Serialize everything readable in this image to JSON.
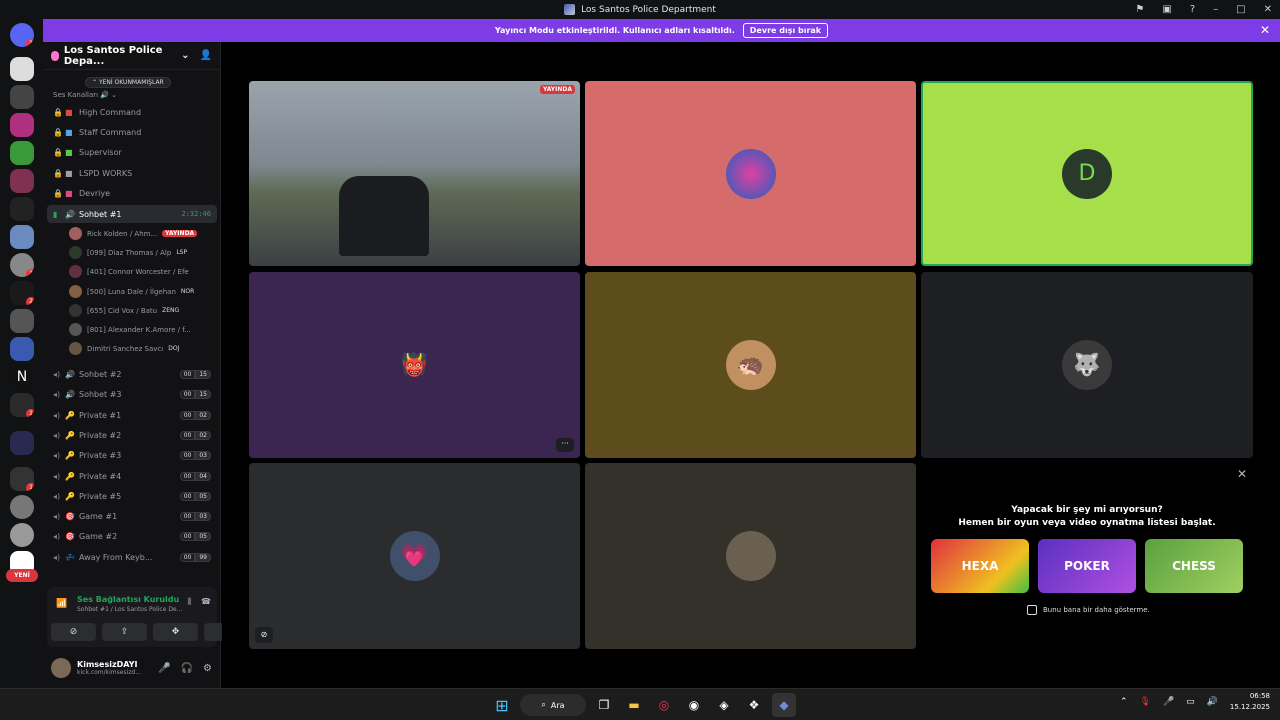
{
  "window": {
    "title": "Los Santos Police Department"
  },
  "banner": {
    "text": "Yayıncı Modu etkinleştirildi. Kullanıcı adları kısaltıldı.",
    "button": "Devre dışı bırak"
  },
  "guild_badges": {
    "top": "3",
    "b1": "1",
    "b2": "2",
    "b3": "1",
    "b4": "1"
  },
  "guild_new_label": "YENİ",
  "sidebar": {
    "server_name": "Los Santos Police Depa...",
    "unread_pill": "YENİ OKUNMAMIŞLAR",
    "category": "Ses Kanalları",
    "channels_top": [
      {
        "name": "High Command",
        "color": "#e0493e"
      },
      {
        "name": "Staff Command",
        "color": "#4ea8e6"
      },
      {
        "name": "Supervisor",
        "color": "#57c94e"
      },
      {
        "name": "LSPD WORKS",
        "color": "#9aa0a6"
      },
      {
        "name": "Devriye",
        "color": "#e34a7a"
      }
    ],
    "active_channel": {
      "name": "Sohbet #1",
      "timer": "2:32:46"
    },
    "members": [
      {
        "name": "Rick Kolden / Ahm...",
        "tag": "YAYINDA"
      },
      {
        "name": "[099] Diaz Thomas / Alp",
        "tag": "LSP"
      },
      {
        "name": "[401] Connor Worcester / Efe",
        "tag": ""
      },
      {
        "name": "[500] Luna Dale / İlgehan",
        "tag": "NOR"
      },
      {
        "name": "[655] Cid Vox / Batu",
        "tag": "ZENG"
      },
      {
        "name": "[801] Alexander K.Amore / f...",
        "tag": ""
      },
      {
        "name": "Dimitri Sanchez Savcı",
        "tag": "DOJ"
      }
    ],
    "channels_bottom": [
      {
        "name": "Sohbet #2",
        "a": "00",
        "b": "15",
        "icon": "🔊"
      },
      {
        "name": "Sohbet #3",
        "a": "00",
        "b": "15",
        "icon": "🔊"
      },
      {
        "name": "Private #1",
        "a": "00",
        "b": "02",
        "icon": "🔑"
      },
      {
        "name": "Private #2",
        "a": "00",
        "b": "02",
        "icon": "🔑"
      },
      {
        "name": "Private #3",
        "a": "00",
        "b": "03",
        "icon": "🔑"
      },
      {
        "name": "Private #4",
        "a": "00",
        "b": "04",
        "icon": "🔑"
      },
      {
        "name": "Private #5",
        "a": "00",
        "b": "05",
        "icon": "🔑"
      },
      {
        "name": "Game #1",
        "a": "00",
        "b": "03",
        "icon": "🎯"
      },
      {
        "name": "Game #2",
        "a": "00",
        "b": "05",
        "icon": "🎯"
      },
      {
        "name": "Away From Keyb...",
        "a": "00",
        "b": "99",
        "icon": "💤"
      }
    ]
  },
  "voice": {
    "status": "Ses Bağlantısı Kuruldu",
    "channel": "Sohbet #1 / Los Santos Police De..."
  },
  "user": {
    "name": "KimsesizDAYI",
    "status": "kick.com/kimsesizd..."
  },
  "stage": {
    "live_label": "YAYINDA"
  },
  "activity": {
    "heading1": "Yapacak bir şey mi arıyorsun?",
    "heading2": "Hemen bir oyun veya video oynatma listesi başlat.",
    "games": [
      "HEXA",
      "POKER",
      "CHESS"
    ],
    "checkbox": "Bunu bana bir daha gösterme."
  },
  "taskbar": {
    "search": "Ara",
    "time": "06:58",
    "date": "15.12.2025"
  }
}
